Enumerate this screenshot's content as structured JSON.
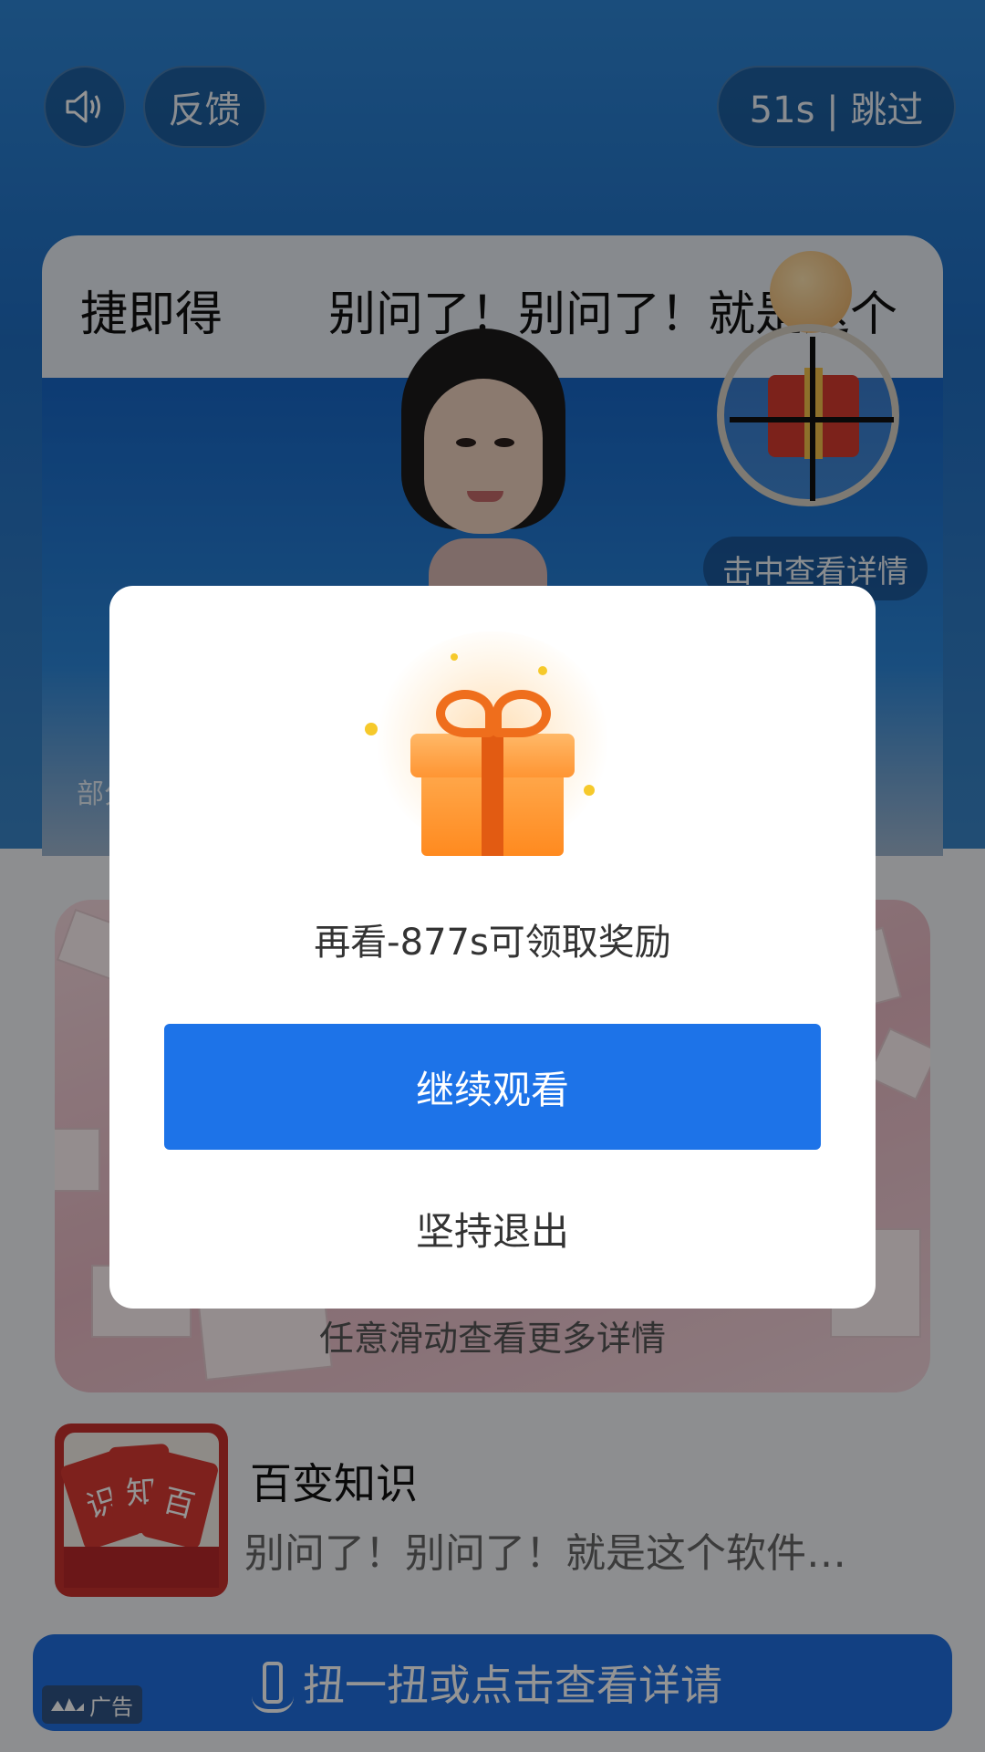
{
  "top_controls": {
    "feedback_label": "反馈",
    "skip_label": "51s | 跳过"
  },
  "video": {
    "marquee_left": "捷即得",
    "marquee_right": "别问了！别问了！就是这个",
    "hit_detail_label": "击中查看详情",
    "partial_text": "部分"
  },
  "promo": {
    "swipe_hint": "任意滑动查看更多详情"
  },
  "app": {
    "name": "百变知识",
    "description": "别问了！别问了！就是这个软件…",
    "icon_letters": [
      "识",
      "知",
      "百"
    ]
  },
  "cta": {
    "label": "扭一扭或点击查看详请"
  },
  "ad_badge": {
    "label": "广告"
  },
  "dialog": {
    "message": "再看-877s可领取奖励",
    "continue_label": "继续观看",
    "quit_label": "坚持退出"
  },
  "colors": {
    "primary_button": "#1d73e8",
    "cta_bar": "#1f6fe0",
    "gift_orange": "#ff8a1f"
  }
}
